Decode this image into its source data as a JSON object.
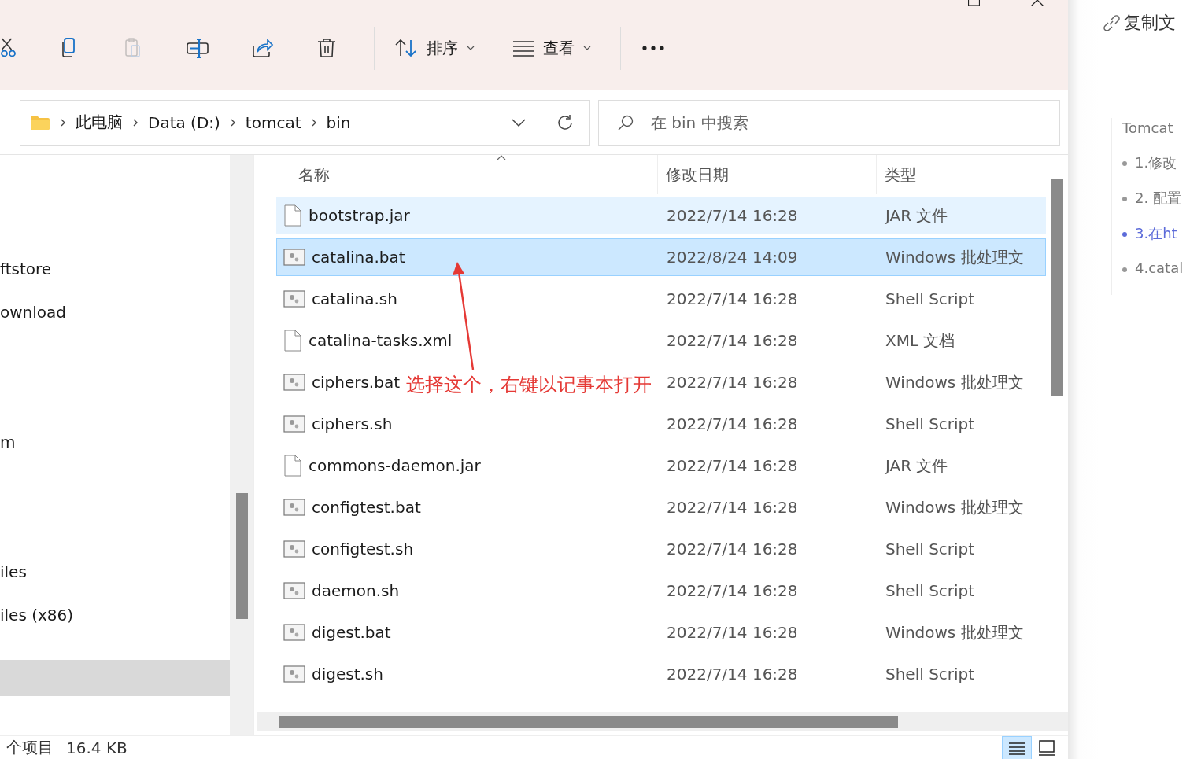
{
  "toolbar": {
    "buttons": [
      {
        "kind": "cut",
        "disabled": false
      },
      {
        "kind": "copy",
        "disabled": false
      },
      {
        "kind": "paste",
        "disabled": true
      },
      {
        "kind": "rename",
        "disabled": false
      },
      {
        "kind": "share",
        "disabled": false
      },
      {
        "kind": "delete",
        "disabled": false
      }
    ],
    "sort": {
      "label": "排序"
    },
    "view": {
      "label": "查看"
    }
  },
  "address": {
    "crumbs": [
      "此电脑",
      "Data (D:)",
      "tomcat",
      "bin"
    ]
  },
  "search": {
    "placeholder": "在 bin 中搜索"
  },
  "nav_items": [
    {
      "label": "ftstore",
      "selected": false
    },
    {
      "label": "ownload",
      "selected": false
    },
    {
      "label": "m",
      "selected": false
    },
    {
      "label": "iles",
      "selected": false
    },
    {
      "label": "iles (x86)",
      "selected": false
    },
    {
      "selected": true
    }
  ],
  "table": {
    "columns": [
      "名称",
      "修改日期",
      "类型"
    ],
    "rows": [
      {
        "name": "bootstrap.jar",
        "date": "2022/7/14 16:28",
        "type": "JAR 文件",
        "kind": "file",
        "selected": false,
        "hovered": true
      },
      {
        "name": "catalina.bat",
        "date": "2022/8/24 14:09",
        "type": "Windows 批处理文",
        "kind": "script",
        "selected": true,
        "hovered": false
      },
      {
        "name": "catalina.sh",
        "date": "2022/7/14 16:28",
        "type": "Shell Script",
        "kind": "script",
        "selected": false,
        "hovered": false
      },
      {
        "name": "catalina-tasks.xml",
        "date": "2022/7/14 16:28",
        "type": "XML 文档",
        "kind": "file",
        "selected": false,
        "hovered": false
      },
      {
        "name": "ciphers.bat",
        "date": "2022/7/14 16:28",
        "type": "Windows 批处理文",
        "kind": "script",
        "selected": false,
        "hovered": false
      },
      {
        "name": "ciphers.sh",
        "date": "2022/7/14 16:28",
        "type": "Shell Script",
        "kind": "script",
        "selected": false,
        "hovered": false
      },
      {
        "name": "commons-daemon.jar",
        "date": "2022/7/14 16:28",
        "type": "JAR 文件",
        "kind": "file",
        "selected": false,
        "hovered": false
      },
      {
        "name": "configtest.bat",
        "date": "2022/7/14 16:28",
        "type": "Windows 批处理文",
        "kind": "script",
        "selected": false,
        "hovered": false
      },
      {
        "name": "configtest.sh",
        "date": "2022/7/14 16:28",
        "type": "Shell Script",
        "kind": "script",
        "selected": false,
        "hovered": false
      },
      {
        "name": "daemon.sh",
        "date": "2022/7/14 16:28",
        "type": "Shell Script",
        "kind": "script",
        "selected": false,
        "hovered": false
      },
      {
        "name": "digest.bat",
        "date": "2022/7/14 16:28",
        "type": "Windows 批处理文",
        "kind": "script",
        "selected": false,
        "hovered": false
      },
      {
        "name": "digest.sh",
        "date": "2022/7/14 16:28",
        "type": "Shell Script",
        "kind": "script",
        "selected": false,
        "hovered": false
      }
    ]
  },
  "annotation": {
    "text": "选择这个，右键以记事本打开"
  },
  "status_bar": {
    "count": "个项目",
    "size": "16.4 KB",
    "views": [
      {
        "kind": "details",
        "selected": true
      },
      {
        "kind": "tiles",
        "selected": false
      }
    ]
  },
  "side_panel": {
    "copy_link": "复制文",
    "toc_title": "Tomcat",
    "toc": [
      {
        "label": "1.修改",
        "selected": false
      },
      {
        "label": "2. 配置",
        "selected": false
      },
      {
        "label": "3.在ht",
        "selected": true
      },
      {
        "label": "4.catal",
        "selected": false
      }
    ]
  }
}
